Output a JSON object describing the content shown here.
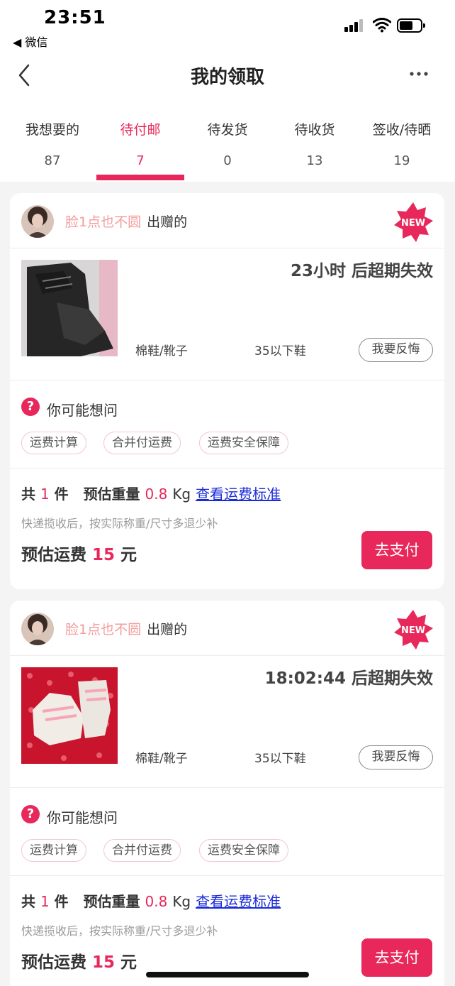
{
  "status_bar": {
    "time": "23:51",
    "back_app": "◀ 微信"
  },
  "nav": {
    "title": "我的领取"
  },
  "tabs": [
    {
      "label": "我想要的",
      "count": "87"
    },
    {
      "label": "待付邮",
      "count": "7"
    },
    {
      "label": "待发货",
      "count": "0"
    },
    {
      "label": "待收货",
      "count": "13"
    },
    {
      "label": "签收/待晒",
      "count": "19"
    }
  ],
  "active_tab": "待付邮",
  "colors": {
    "accent": "#e8285a",
    "giver_name": "#f39c9c",
    "link": "#1a2bd8"
  },
  "cards": [
    {
      "giver_name": "脸1点也不圆",
      "giver_suffix": "出赠的",
      "badge": "NEW",
      "expiry": "23小时 后超期失效",
      "category": "棉鞋/靴子",
      "size": "35以下鞋",
      "regret_label": "我要反悔",
      "faq_title": "你可能想问",
      "faq_chips": [
        "运费计算",
        "合并付运费",
        "运费安全保障"
      ],
      "count_prefix": "共",
      "count": "1",
      "count_unit": "件",
      "weight_label": "预估重量",
      "weight": "0.8",
      "weight_unit": "Kg",
      "fee_link": "查看运费标准",
      "note": "快递揽收后，按实际称重/尺寸多退少补",
      "fee_label": "预估运费",
      "fee": "15",
      "fee_unit": "元",
      "pay_label": "去支付"
    },
    {
      "giver_name": "脸1点也不圆",
      "giver_suffix": "出赠的",
      "badge": "NEW",
      "expiry": "18:02:44 后超期失效",
      "category": "棉鞋/靴子",
      "size": "35以下鞋",
      "regret_label": "我要反悔",
      "faq_title": "你可能想问",
      "faq_chips": [
        "运费计算",
        "合并付运费",
        "运费安全保障"
      ],
      "count_prefix": "共",
      "count": "1",
      "count_unit": "件",
      "weight_label": "预估重量",
      "weight": "0.8",
      "weight_unit": "Kg",
      "fee_link": "查看运费标准",
      "note": "快递揽收后，按实际称重/尺寸多退少补",
      "fee_label": "预估运费",
      "fee": "15",
      "fee_unit": "元",
      "pay_label": "去支付"
    }
  ]
}
